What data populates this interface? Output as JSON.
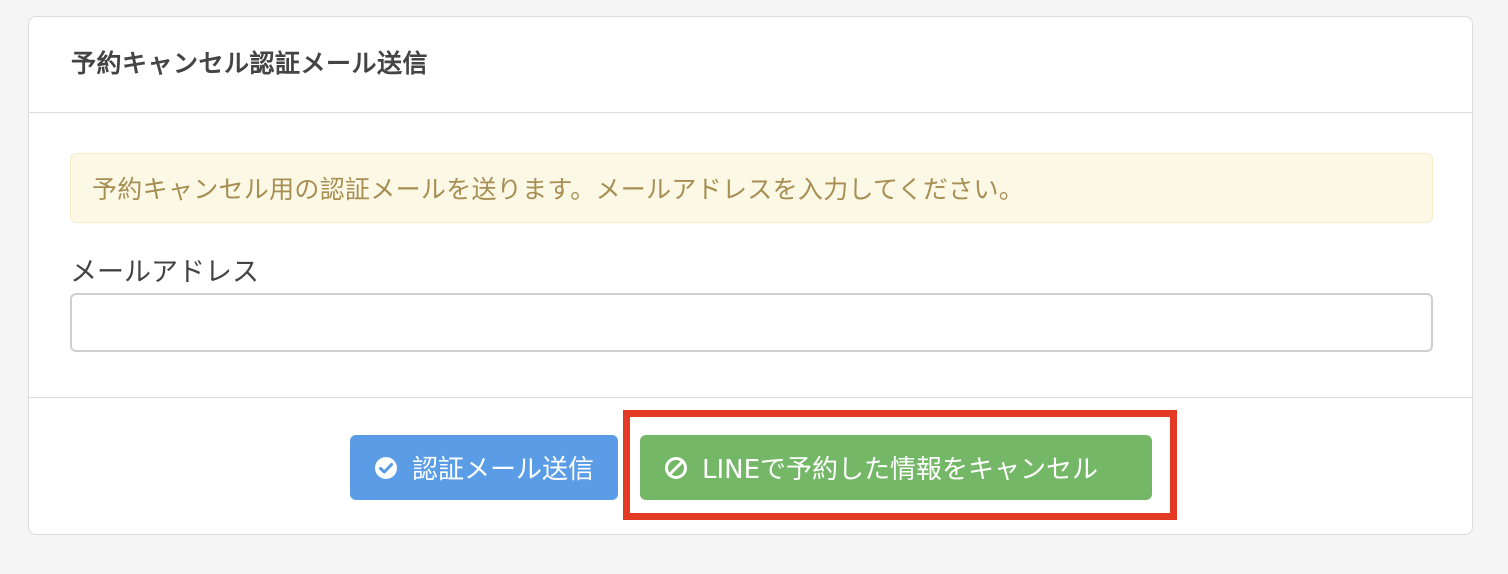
{
  "panel": {
    "title": "予約キャンセル認証メール送信"
  },
  "alert": {
    "message": "予約キャンセル用の認証メールを送ります。メールアドレスを入力してください。"
  },
  "form": {
    "email_label": "メールアドレス",
    "email_value": "",
    "email_placeholder": ""
  },
  "buttons": {
    "send_auth_mail": {
      "label": "認証メール送信",
      "icon": "check-circle-icon",
      "color": "#5a9de6"
    },
    "cancel_line_reservation": {
      "label": "LINEで予約した情報をキャンセル",
      "icon": "ban-icon",
      "color": "#74b766"
    }
  },
  "highlight": {
    "color": "#e33a26",
    "target": "cancel_line_reservation"
  }
}
